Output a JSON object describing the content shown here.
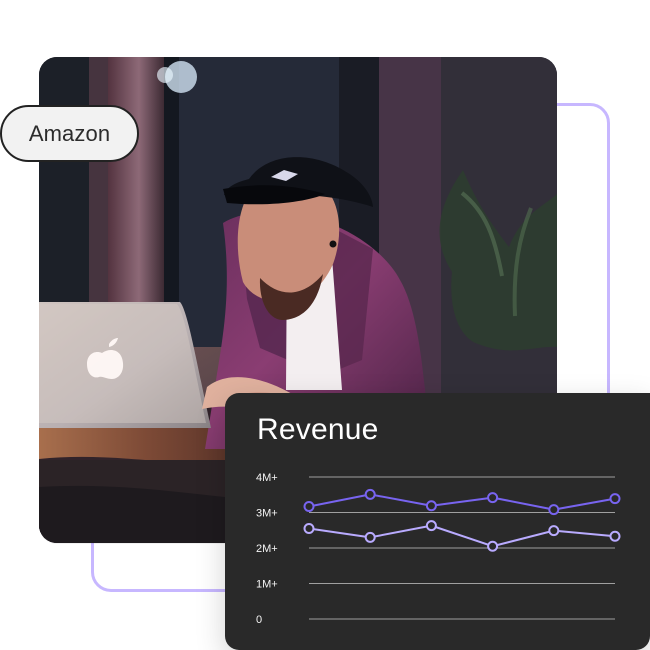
{
  "badge": {
    "label": "Amazon"
  },
  "photo": {
    "subject": "person-working-on-laptop"
  },
  "revenue_card": {
    "title": "Revenue"
  },
  "colors": {
    "accent": "#c7b7ff",
    "series_1": "#7864f0",
    "series_2": "#b9abff",
    "card_background": "#292929",
    "grid": "#cfcfcf",
    "text": "#ffffff"
  },
  "chart_data": {
    "type": "line",
    "title": "Revenue",
    "xlabel": "",
    "ylabel": "",
    "x": [
      1,
      2,
      3,
      4,
      5,
      6
    ],
    "y_ticks": [
      0,
      1000000,
      2000000,
      3000000,
      4000000
    ],
    "y_tick_labels": [
      "0",
      "1M+",
      "2M+",
      "3M+",
      "4M+"
    ],
    "ylim": [
      0,
      4000000
    ],
    "grid": true,
    "legend": "none",
    "series": [
      {
        "values": [
          3170000,
          3510000,
          3190000,
          3420000,
          3080000,
          3390000
        ],
        "color": "#7864f0"
      },
      {
        "values": [
          2550000,
          2300000,
          2630000,
          2050000,
          2490000,
          2330000
        ],
        "color": "#b9abff"
      }
    ]
  }
}
